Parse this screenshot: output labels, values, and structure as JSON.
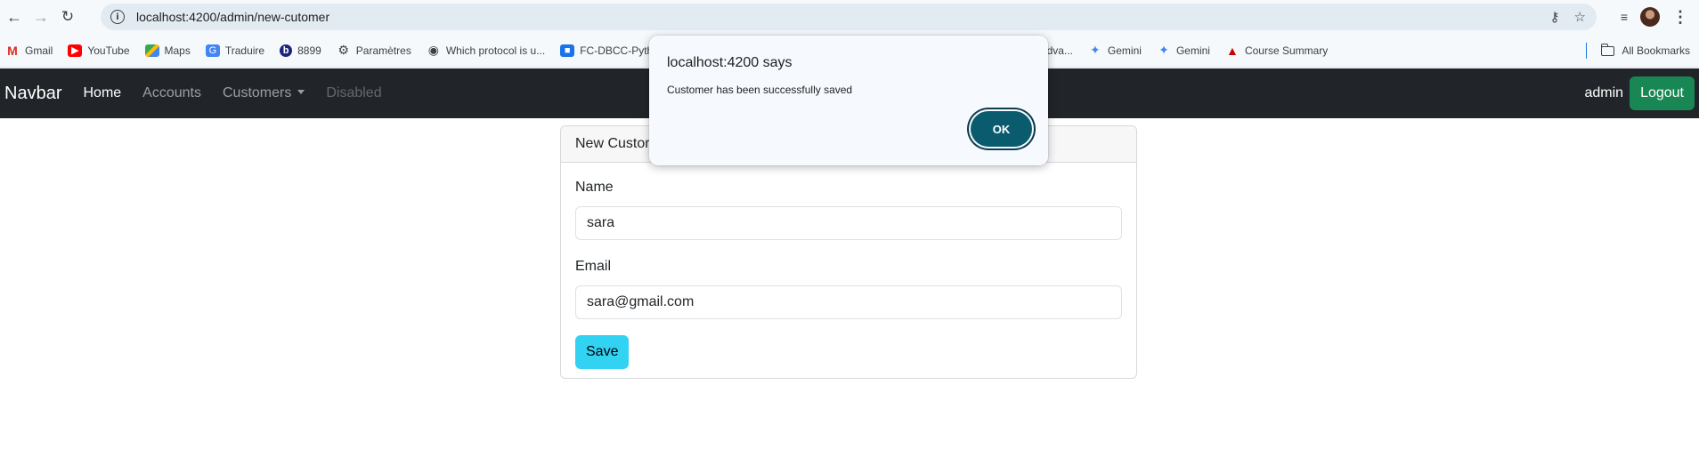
{
  "browser": {
    "url": "localhost:4200/admin/new-cutomer",
    "bookmarks": [
      {
        "label": "Gmail",
        "icon": "gmail-icon"
      },
      {
        "label": "YouTube",
        "icon": "youtube-icon"
      },
      {
        "label": "Maps",
        "icon": "maps-icon"
      },
      {
        "label": "Traduire",
        "icon": "translate-icon"
      },
      {
        "label": "8899",
        "icon": "b-icon"
      },
      {
        "label": "Paramètres",
        "icon": "gear-icon"
      },
      {
        "label": "Which protocol is u...",
        "icon": "globe-icon"
      },
      {
        "label": "FC-DBCC-Python",
        "icon": "id-card-icon"
      },
      {
        "label": "dva...",
        "icon": "page-icon"
      },
      {
        "label": "Gemini",
        "icon": "gemini-icon"
      },
      {
        "label": "Gemini",
        "icon": "gemini-icon"
      },
      {
        "label": "Course Summary",
        "icon": "redhat-icon"
      }
    ],
    "all_bookmarks_label": "All Bookmarks"
  },
  "navbar": {
    "brand": "Navbar",
    "links": {
      "home": "Home",
      "accounts": "Accounts",
      "customers": "Customers",
      "disabled": "Disabled"
    },
    "user": "admin",
    "logout_label": "Logout",
    "colors": {
      "background": "#212529",
      "logout": "#198754"
    }
  },
  "card": {
    "header": "New Custor",
    "name_label": "Name",
    "name_value": "sara",
    "email_label": "Email",
    "email_value": "sara@gmail.com",
    "save_label": "Save",
    "colors": {
      "save": "#31d2f2"
    }
  },
  "dialog": {
    "title": "localhost:4200 says",
    "message": "Customer has been successfully  saved",
    "ok_label": "OK",
    "colors": {
      "ok": "#0b5b6f"
    }
  }
}
